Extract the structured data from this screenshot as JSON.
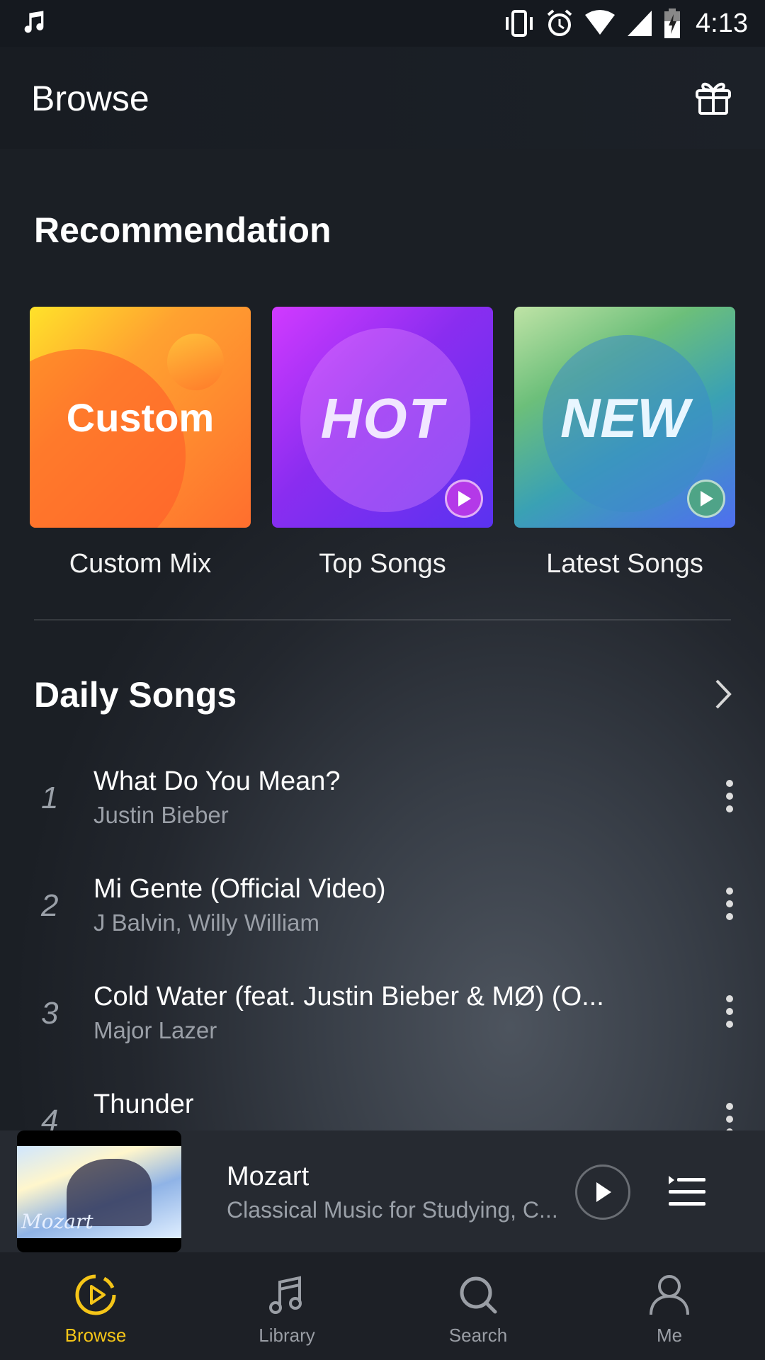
{
  "status_bar": {
    "notification_icon": "music-note-icon",
    "icons": [
      "vibrate-icon",
      "alarm-icon",
      "wifi-icon",
      "cell-signal-icon",
      "battery-charging-icon"
    ],
    "time": "4:13"
  },
  "header": {
    "title": "Browse",
    "action_icon": "gift-icon"
  },
  "recommendation": {
    "title": "Recommendation",
    "cards": [
      {
        "art_text": "Custom",
        "label": "Custom Mix",
        "has_play": false
      },
      {
        "art_text": "HOT",
        "label": "Top Songs",
        "has_play": true
      },
      {
        "art_text": "NEW",
        "label": "Latest Songs",
        "has_play": true
      }
    ]
  },
  "daily_songs": {
    "title": "Daily Songs",
    "songs": [
      {
        "rank": "1",
        "title": "What Do You Mean?",
        "artist": "Justin Bieber"
      },
      {
        "rank": "2",
        "title": "Mi Gente (Official Video)",
        "artist": "J Balvin, Willy William"
      },
      {
        "rank": "3",
        "title": "Cold Water (feat. Justin Bieber & MØ) (O...",
        "artist": "Major Lazer"
      },
      {
        "rank": "4",
        "title": "Thunder",
        "artist": ""
      }
    ]
  },
  "mini_player": {
    "art_text": "Mozart",
    "title": "Mozart",
    "subtitle": "Classical Music for Studying, C..."
  },
  "tabs": [
    {
      "label": "Browse",
      "icon": "browse-icon",
      "active": true
    },
    {
      "label": "Library",
      "icon": "library-icon",
      "active": false
    },
    {
      "label": "Search",
      "icon": "search-icon",
      "active": false
    },
    {
      "label": "Me",
      "icon": "profile-icon",
      "active": false
    }
  ],
  "colors": {
    "accent": "#f5c518",
    "inactive": "#9a9ea5"
  }
}
